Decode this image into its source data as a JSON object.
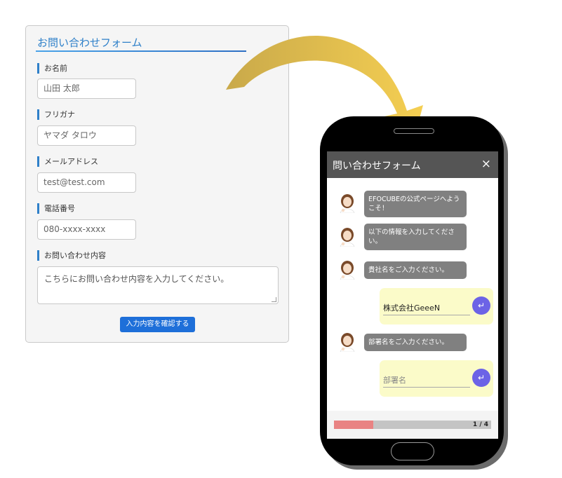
{
  "form": {
    "title": "お問い合わせフォーム",
    "fields": [
      {
        "label": "お名前",
        "value": "山田 太郎"
      },
      {
        "label": "フリガナ",
        "value": "ヤマダ タロウ"
      },
      {
        "label": "メールアドレス",
        "value": "test@test.com"
      },
      {
        "label": "電話番号",
        "value": "080-xxxx-xxxx"
      }
    ],
    "message": {
      "label": "お問い合わせ内容",
      "placeholder": "こちらにお問い合わせ内容を入力してください。"
    },
    "confirm_button": "入力内容を確認する",
    "accent_color": "#2f80c9",
    "button_color": "#1e6fd9"
  },
  "arrow": {
    "color_start": "#c9a94a",
    "color_end": "#f5cf52"
  },
  "chat": {
    "title": "問い合わせフォーム",
    "close_icon": "×",
    "messages": [
      "EFOCUBEの公式ページへようこそ！",
      "以下の情報を入力してください。",
      "貴社名をご入力ください。",
      "部署名をご入力ください。"
    ],
    "answers": {
      "company_value": "株式会社GeeeN",
      "department_placeholder": "部署名"
    },
    "send_icon": "↵",
    "progress": {
      "text": "1 / 4",
      "fraction": 0.25,
      "fill_color": "#e98383"
    }
  }
}
